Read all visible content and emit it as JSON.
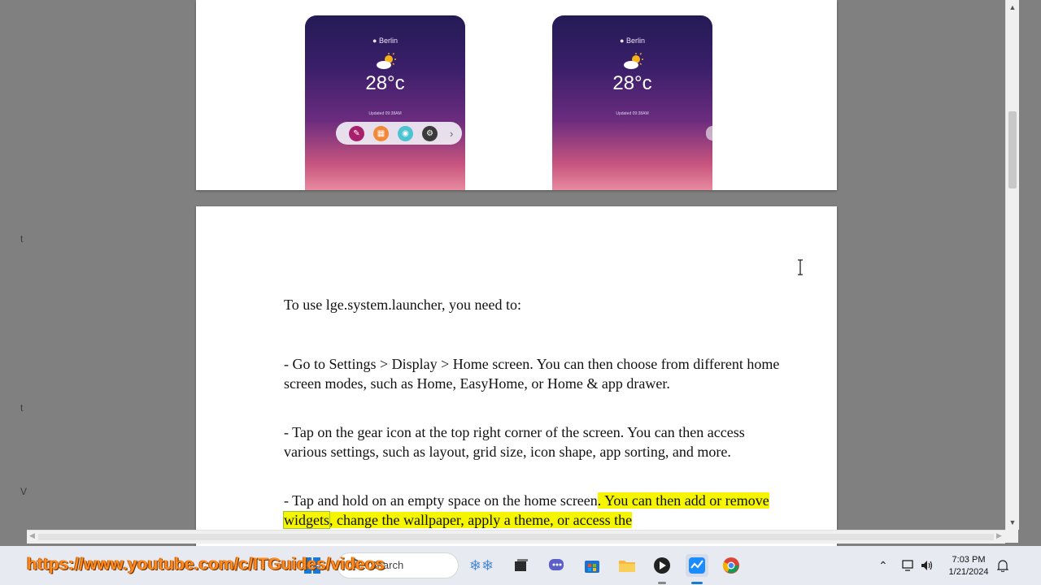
{
  "viewer": {
    "left_strip_marks": [
      "t",
      "t",
      "V"
    ]
  },
  "phones": [
    {
      "city": "Berlin",
      "temperature": "28°c",
      "updated": "Updated 09:38AM",
      "has_dock": true
    },
    {
      "city": "Berlin",
      "temperature": "28°c",
      "updated": "Updated 09:38AM",
      "has_dock": false
    }
  ],
  "document": {
    "intro": "To use lge.system.launcher, you need to:",
    "para1": "- Go to Settings > Display > Home screen. You can then choose from different home screen modes, such as Home, EasyHome, or Home & app drawer.",
    "para2": "- Tap on the gear icon at the top right corner of the screen. You can then access various settings, such as layout, grid size, icon shape, app sorting, and more.",
    "para3_plain": "- Tap and hold on an empty space on the home screen",
    "para3_hl_a": ". You can then add or remove ",
    "para3_hl_word": "widgets",
    "para3_hl_b": ", change the wallpaper, apply a theme, or access the"
  },
  "overlay": {
    "url": "https://www.youtube.com/c/ITGuides/videos"
  },
  "taskbar": {
    "search_placeholder": "Search",
    "time": "7:03 PM",
    "date": "1/21/2024"
  },
  "colors": {
    "highlight": "#f5f500",
    "url_orange": "#ff8a1f"
  }
}
